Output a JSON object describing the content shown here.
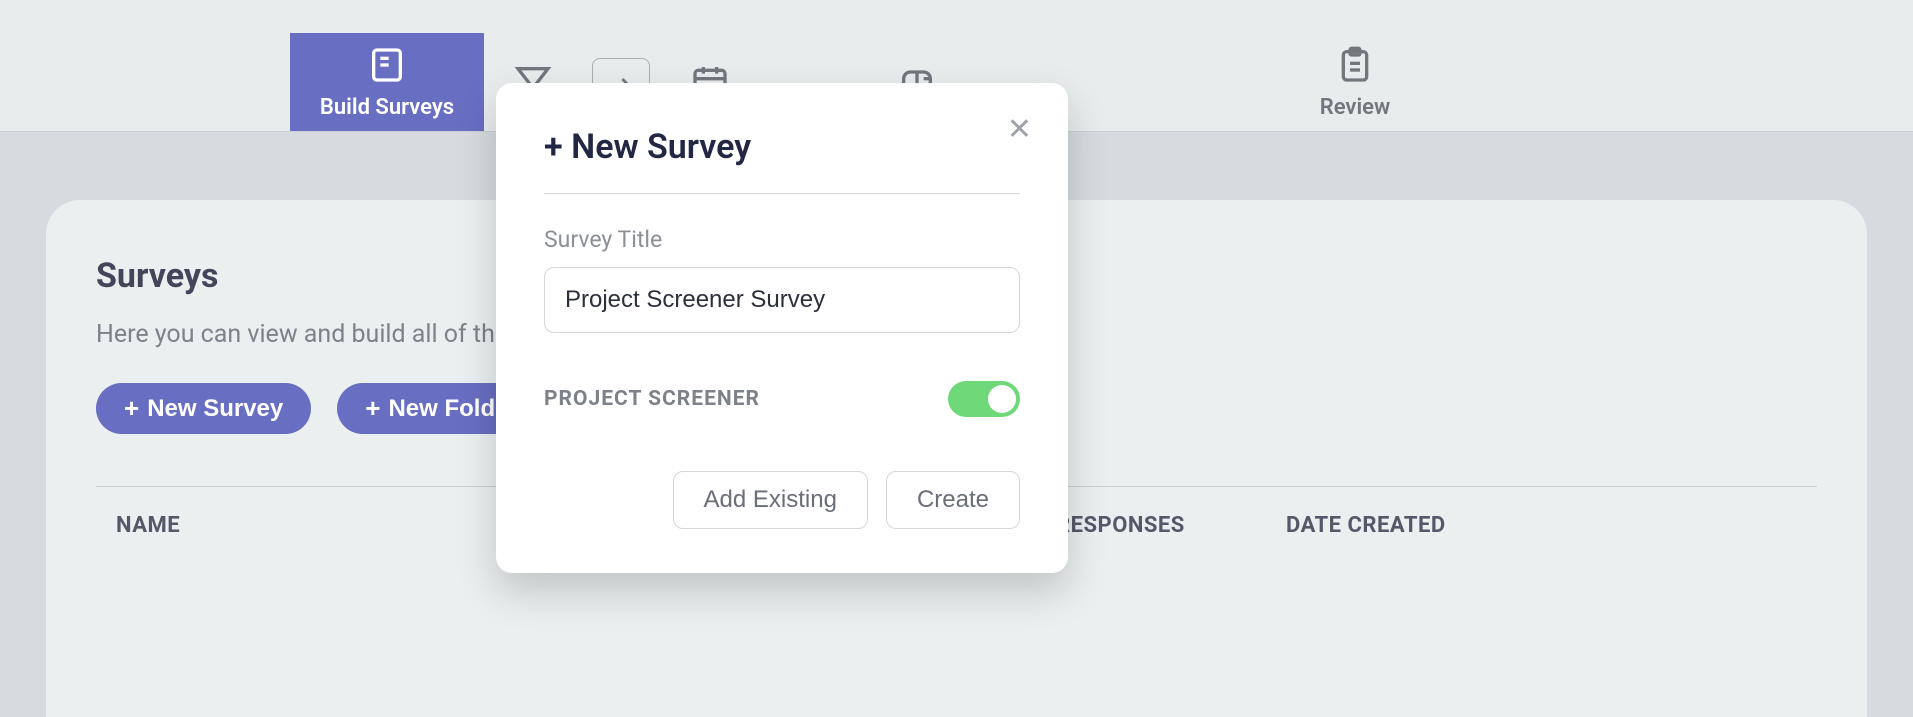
{
  "tabs": {
    "build": "Build Surveys",
    "review": "Review"
  },
  "page": {
    "title": "Surveys",
    "description": "Here you can view and build all of the",
    "new_survey_btn": "New Survey",
    "new_folder_btn": "New Folder"
  },
  "table": {
    "col_name": "NAME",
    "col_responses": "RESPONSES",
    "col_date": "DATE CREATED"
  },
  "modal": {
    "title": "+ New Survey",
    "field_label": "Survey Title",
    "field_value": "Project Screener Survey",
    "toggle_label": "PROJECT SCREENER",
    "toggle_on": true,
    "add_existing": "Add Existing",
    "create": "Create"
  }
}
